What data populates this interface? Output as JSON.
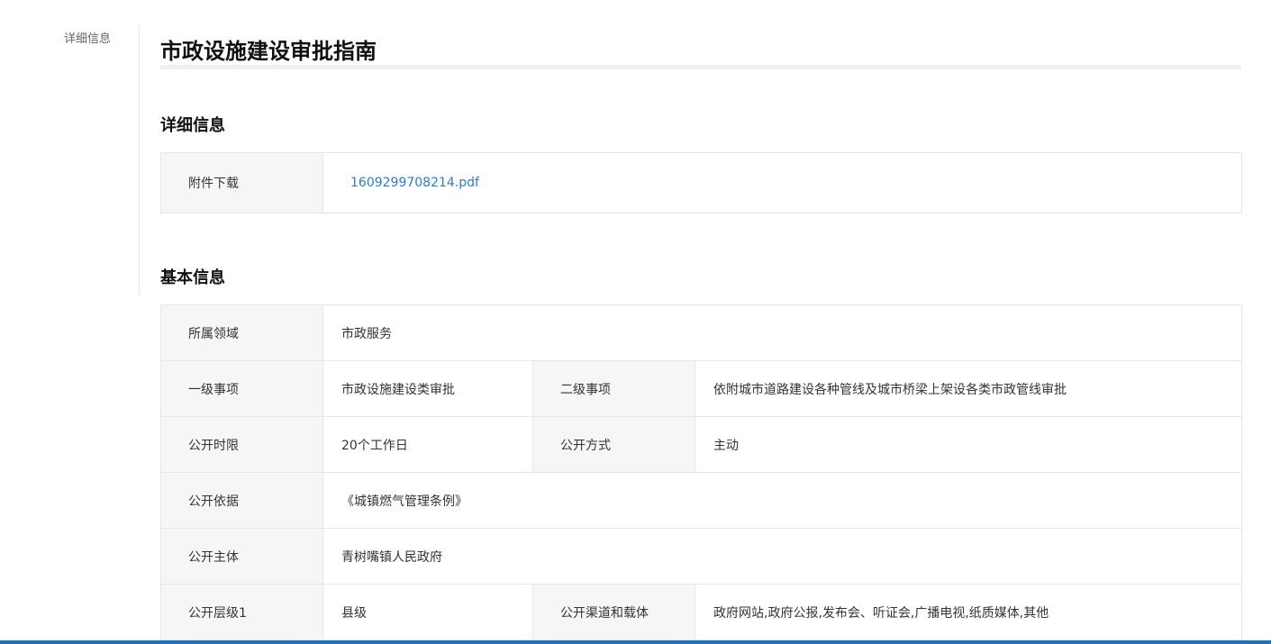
{
  "side_nav": {
    "items": [
      "详细信息"
    ]
  },
  "page_title": "市政设施建设审批指南",
  "detail_section": {
    "heading": "详细信息",
    "attachment_label": "附件下载",
    "attachment_file": "1609299708214.pdf"
  },
  "basic_section": {
    "heading": "基本信息",
    "rows": [
      {
        "label1": "所属领域",
        "value1": "市政服务"
      },
      {
        "label1": "一级事项",
        "value1": "市政设施建设类审批",
        "label2": "二级事项",
        "value2": "依附城市道路建设各种管线及城市桥梁上架设各类市政管线审批"
      },
      {
        "label1": "公开时限",
        "value1": "20个工作日",
        "label2": "公开方式",
        "value2": "主动"
      },
      {
        "label1": "公开依据",
        "value1": "《城镇燃气管理条例》"
      },
      {
        "label1": "公开主体",
        "value1": "青树嘴镇人民政府"
      },
      {
        "label1": "公开层级1",
        "value1": "县级",
        "label2": "公开渠道和载体",
        "value2": "政府网站,政府公报,发布会、听证会,广播电视,纸质媒体,其他"
      }
    ]
  },
  "colors": {
    "link": "#2b7cd3",
    "label_bg": "#f5f6f8",
    "bottom_bar": "#1f6fc5"
  }
}
